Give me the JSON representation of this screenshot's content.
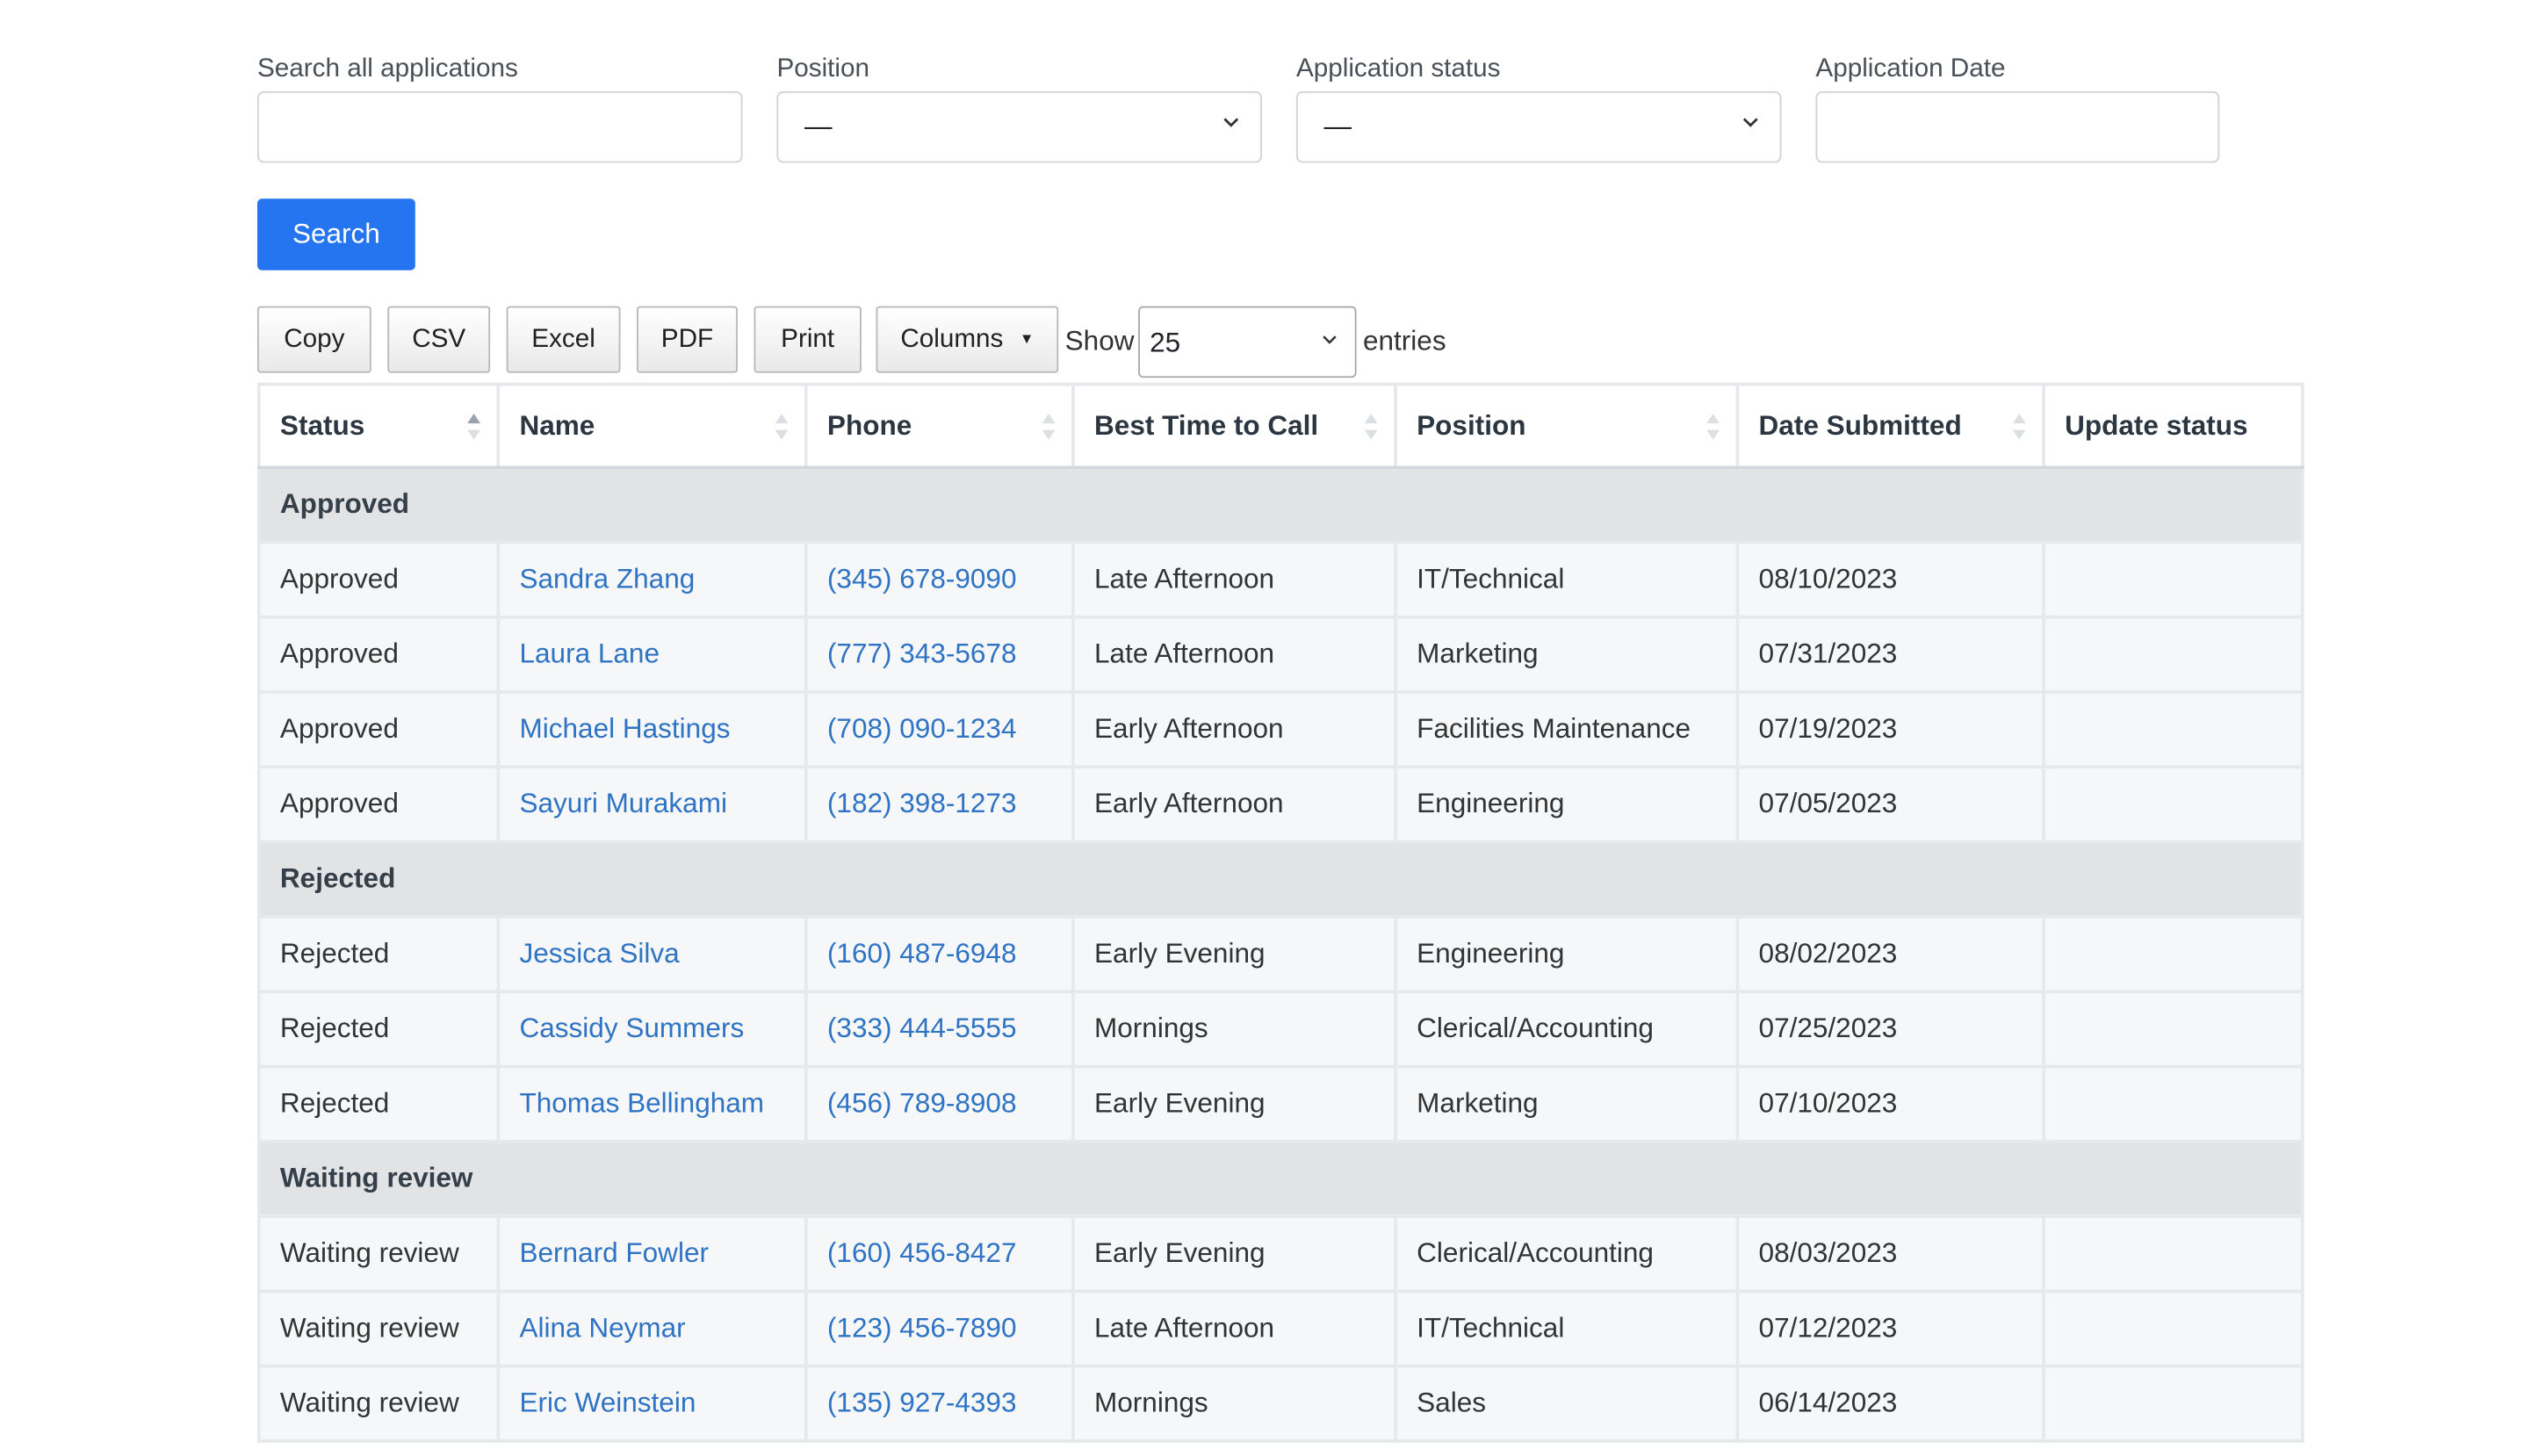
{
  "filters": {
    "search": {
      "label": "Search all applications",
      "value": ""
    },
    "position": {
      "label": "Position",
      "value": "—"
    },
    "status": {
      "label": "Application status",
      "value": "—"
    },
    "date": {
      "label": "Application Date",
      "value": ""
    }
  },
  "search_button": "Search",
  "toolbar": {
    "copy": "Copy",
    "csv": "CSV",
    "excel": "Excel",
    "pdf": "PDF",
    "print": "Print",
    "columns": "Columns",
    "show": "Show",
    "entries_value": "25",
    "entries": "entries"
  },
  "table": {
    "headers": [
      "Status",
      "Name",
      "Phone",
      "Best Time to Call",
      "Position",
      "Date Submitted",
      "Update status"
    ],
    "groups": [
      {
        "label": "Approved",
        "rows": [
          [
            "Approved",
            "Sandra Zhang",
            "(345) 678-9090",
            "Late Afternoon",
            "IT/Technical",
            "08/10/2023",
            ""
          ],
          [
            "Approved",
            "Laura Lane",
            "(777) 343-5678",
            "Late Afternoon",
            "Marketing",
            "07/31/2023",
            ""
          ],
          [
            "Approved",
            "Michael Hastings",
            "(708) 090-1234",
            "Early Afternoon",
            "Facilities Maintenance",
            "07/19/2023",
            ""
          ],
          [
            "Approved",
            "Sayuri Murakami",
            "(182) 398-1273",
            "Early Afternoon",
            "Engineering",
            "07/05/2023",
            ""
          ]
        ]
      },
      {
        "label": "Rejected",
        "rows": [
          [
            "Rejected",
            "Jessica Silva",
            "(160) 487-6948",
            "Early Evening",
            "Engineering",
            "08/02/2023",
            ""
          ],
          [
            "Rejected",
            "Cassidy Summers",
            "(333) 444-5555",
            "Mornings",
            "Clerical/Accounting",
            "07/25/2023",
            ""
          ],
          [
            "Rejected",
            "Thomas Bellingham",
            "(456) 789-8908",
            "Early Evening",
            "Marketing",
            "07/10/2023",
            ""
          ]
        ]
      },
      {
        "label": "Waiting review",
        "rows": [
          [
            "Waiting review",
            "Bernard Fowler",
            "(160) 456-8427",
            "Early Evening",
            "Clerical/Accounting",
            "08/03/2023",
            ""
          ],
          [
            "Waiting review",
            "Alina Neymar",
            "(123) 456-7890",
            "Late Afternoon",
            "IT/Technical",
            "07/12/2023",
            ""
          ],
          [
            "Waiting review",
            "Eric Weinstein",
            "(135) 927-4393",
            "Mornings",
            "Sales",
            "06/14/2023",
            ""
          ]
        ]
      }
    ]
  }
}
